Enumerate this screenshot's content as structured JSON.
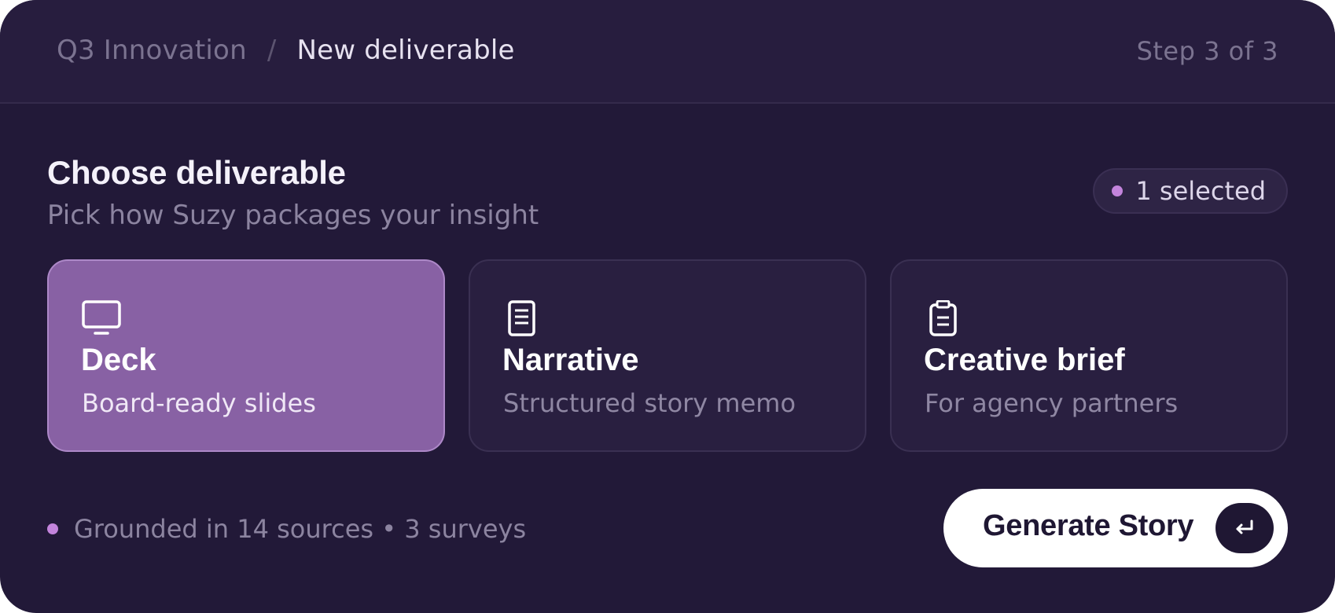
{
  "header": {
    "breadcrumb_parent": "Q3 Innovation",
    "breadcrumb_separator": "/",
    "breadcrumb_current": "New deliverable",
    "step_text": "Step 3 of 3"
  },
  "section": {
    "title": "Choose deliverable",
    "subtitle": "Pick how Suzy packages your insight",
    "selected_badge": "1 selected"
  },
  "options": [
    {
      "icon": "monitor-icon",
      "title": "Deck",
      "description": "Board-ready slides",
      "selected": true
    },
    {
      "icon": "document-icon",
      "title": "Narrative",
      "description": "Structured story memo",
      "selected": false
    },
    {
      "icon": "clipboard-icon",
      "title": "Creative brief",
      "description": "For agency partners",
      "selected": false
    }
  ],
  "footer": {
    "grounding_text": "Grounded in 14 sources • 3 surveys",
    "generate_label": "Generate Story",
    "generate_key_icon": "enter-key-icon"
  },
  "colors": {
    "background": "#221938",
    "accent": "#c384dc",
    "selected_card": "#8861a4",
    "button": "#ffffff"
  }
}
